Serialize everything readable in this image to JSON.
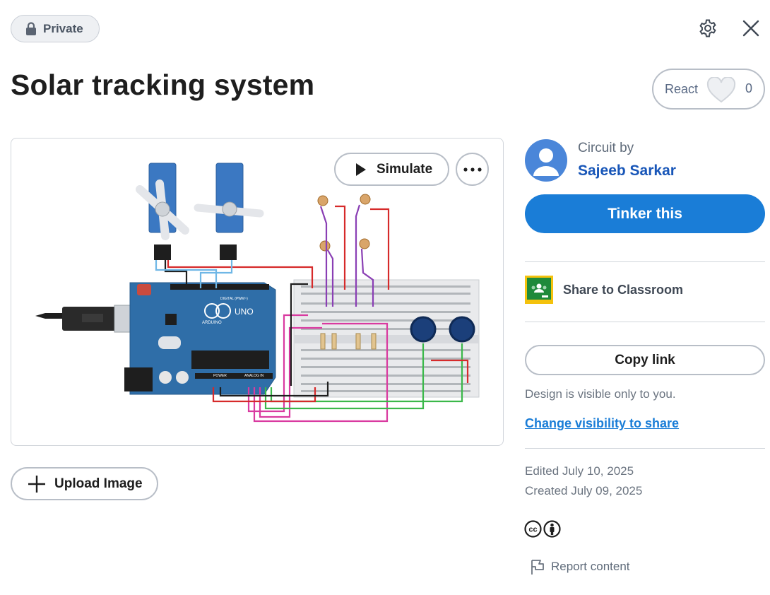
{
  "header": {
    "privacy_label": "Private",
    "title": "Solar tracking system"
  },
  "react": {
    "label": "React",
    "count": "0"
  },
  "preview": {
    "simulate_label": "Simulate",
    "upload_label": "Upload Image",
    "board_text": {
      "uno": "UNO",
      "arduino": "ARDUINO",
      "digital": "DIGITAL (PWM~)",
      "power": "POWER",
      "analog": "ANALOG IN"
    }
  },
  "author": {
    "circuit_by": "Circuit by",
    "name": "Sajeeb Sarkar"
  },
  "actions": {
    "tinker_label": "Tinker this",
    "classroom_label": "Share to Classroom",
    "copy_link_label": "Copy link",
    "visibility_note": "Design is visible only to you.",
    "visibility_link": "Change visibility to share"
  },
  "meta": {
    "edited": "Edited July 10, 2025",
    "created": "Created July 09, 2025",
    "report_label": "Report content"
  },
  "colors": {
    "primary_blue": "#1a7dd7",
    "author_blue": "#1856b8",
    "arduino_blue": "#2f6ea8",
    "servo_blue": "#3b78c2",
    "classroom_green": "#1f8a3a",
    "classroom_yellow": "#f4c20d"
  },
  "icons": {
    "lock": "lock-icon",
    "gear": "gear-icon",
    "close": "close-icon",
    "heart": "heart-icon",
    "play": "play-icon",
    "more": "more-icon",
    "plus": "plus-icon",
    "avatar": "avatar-icon",
    "classroom": "google-classroom-icon",
    "cc": "creative-commons-icon",
    "by": "attribution-icon",
    "flag": "flag-icon"
  }
}
